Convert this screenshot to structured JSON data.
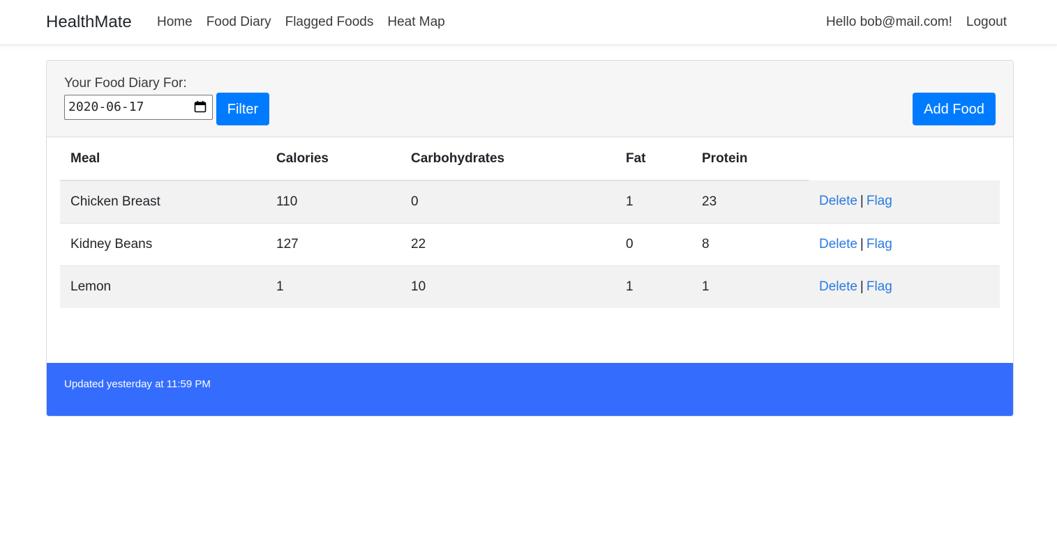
{
  "nav": {
    "brand": "HealthMate",
    "links": [
      "Home",
      "Food Diary",
      "Flagged Foods",
      "Heat Map"
    ],
    "greeting": "Hello bob@mail.com!",
    "logout": "Logout"
  },
  "diary": {
    "label": "Your Food Diary For:",
    "date_value": "2020-06-17",
    "filter_label": "Filter",
    "add_label": "Add Food"
  },
  "table": {
    "headers": [
      "Meal",
      "Calories",
      "Carbohydrates",
      "Fat",
      "Protein"
    ],
    "rows": [
      {
        "meal": "Chicken Breast",
        "calories": "110",
        "carbs": "0",
        "fat": "1",
        "protein": "23"
      },
      {
        "meal": "Kidney Beans",
        "calories": "127",
        "carbs": "22",
        "fat": "0",
        "protein": "8"
      },
      {
        "meal": "Lemon",
        "calories": "1",
        "carbs": "10",
        "fat": "1",
        "protein": "1"
      }
    ],
    "delete_label": "Delete",
    "separator": "|",
    "flag_label": "Flag"
  },
  "footer": {
    "text": "Updated yesterday at 11:59 PM"
  },
  "colors": {
    "primary": "#007bff",
    "footer": "#346dfe",
    "link": "#2a7ae2"
  }
}
